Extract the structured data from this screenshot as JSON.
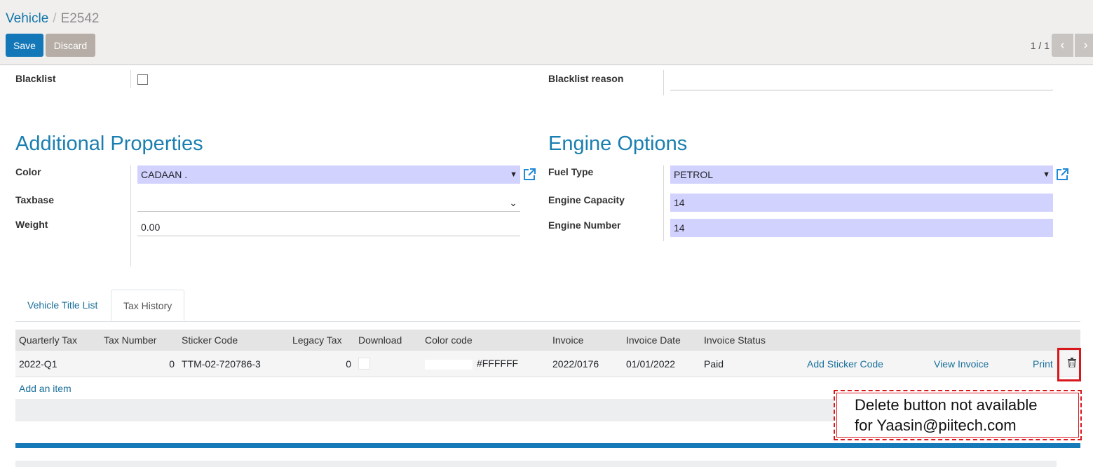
{
  "breadcrumb": {
    "parent": "Vehicle",
    "separator": "/",
    "current": "E2542"
  },
  "toolbar": {
    "save_label": "Save",
    "discard_label": "Discard"
  },
  "pager": {
    "value": "1 / 1",
    "prev_icon": "chevron-left-icon",
    "next_icon": "chevron-right-icon"
  },
  "form": {
    "blacklist_label": "Blacklist",
    "blacklist_reason_label": "Blacklist reason",
    "additional_title": "Additional Properties",
    "engine_title": "Engine Options",
    "color_label": "Color",
    "color_value": "CADAAN .",
    "taxbase_label": "Taxbase",
    "taxbase_value": "",
    "weight_label": "Weight",
    "weight_value": "0.00",
    "fuel_label": "Fuel Type",
    "fuel_value": "PETROL",
    "capacity_label": "Engine Capacity",
    "capacity_value": "14",
    "engine_number_label": "Engine Number",
    "engine_number_value": "14"
  },
  "tabs": [
    {
      "label": "Vehicle Title List",
      "active": false
    },
    {
      "label": "Tax History",
      "active": true
    }
  ],
  "table": {
    "headers": [
      "Quarterly Tax",
      "Tax Number",
      "Sticker Code",
      "Legacy Tax",
      "Download",
      "Color code",
      "Invoice",
      "Invoice Date",
      "Invoice Status",
      "",
      "",
      "",
      ""
    ],
    "rows": [
      {
        "quarterly_tax": "2022-Q1",
        "tax_number": "0",
        "sticker_code": "TTM-02-720786-3",
        "legacy_tax": "0",
        "color_code": "#FFFFFF",
        "invoice": "2022/0176",
        "invoice_date": "01/01/2022",
        "invoice_status": "Paid",
        "add_sticker": "Add Sticker Code",
        "view_invoice": "View Invoice",
        "print": "Print"
      }
    ],
    "add_item": "Add an item"
  },
  "annotation": {
    "line1": "Delete button not available",
    "line2": "for Yaasin@piitech.com",
    "color": "#d8171d"
  },
  "colors": {
    "primary": "#1478b8",
    "required_field": "#d2d2ff",
    "heading": "#1a7fb0"
  }
}
